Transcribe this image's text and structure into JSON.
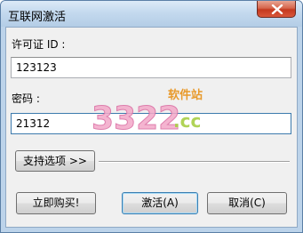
{
  "window": {
    "title": "互联网激活"
  },
  "form": {
    "license_label": "许可证 ID :",
    "license_value": "123123",
    "password_label": "密码 :",
    "password_value": "21312"
  },
  "buttons": {
    "support": "支持选项 >>",
    "buy": "立即购买!",
    "activate": "激活(A)",
    "cancel": "取消(C)"
  },
  "watermark": {
    "number": "3322",
    "domain": ".cc",
    "site_label": "软件站"
  },
  "colors": {
    "accent": "#3c7fb1",
    "close": "#c4391f"
  }
}
